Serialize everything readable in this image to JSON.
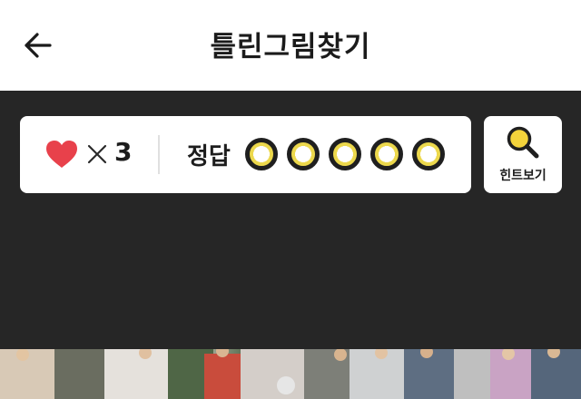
{
  "header": {
    "title": "틀린그림찾기",
    "back_icon": "arrow-left-icon"
  },
  "status": {
    "heart_icon": "heart-icon",
    "heart_color": "#e8414b",
    "times_icon": "times-icon",
    "lives": "3",
    "answer_label": "정답",
    "answer_slot_fill": "#ecd84c",
    "answer_slots": [
      "unfound",
      "unfound",
      "unfound",
      "unfound",
      "unfound"
    ]
  },
  "hint": {
    "label": "힌트보기",
    "icon": "magnifier-icon",
    "icon_color": "#f3d33b"
  },
  "photo": {
    "description_icon": "game-photo"
  }
}
